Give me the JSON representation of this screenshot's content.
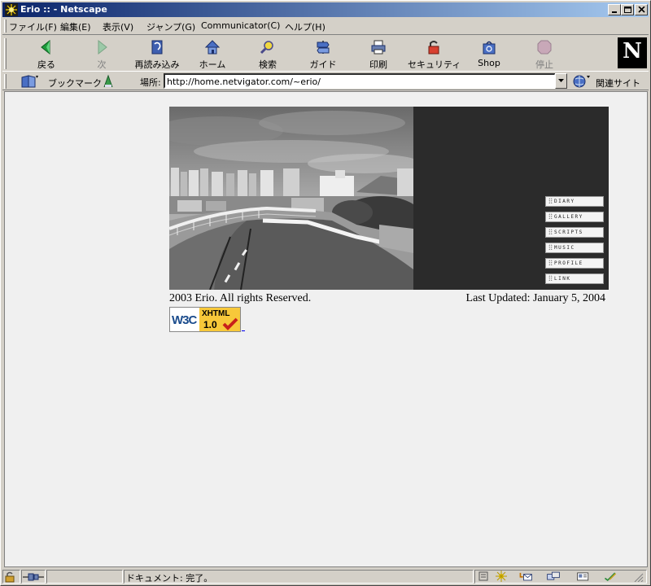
{
  "window": {
    "title": "Erio :: - Netscape"
  },
  "menu": [
    "ファイル(F)",
    "編集(E)",
    "表示(V)",
    "ジャンプ(G)",
    "Communicator(C)",
    "ヘルプ(H)"
  ],
  "toolbar": {
    "buttons": [
      {
        "label": "戻る",
        "icon": "back-icon",
        "enabled": true
      },
      {
        "label": "次",
        "icon": "forward-icon",
        "enabled": false
      },
      {
        "label": "再読み込み",
        "icon": "reload-icon",
        "enabled": true
      },
      {
        "label": "ホーム",
        "icon": "home-icon",
        "enabled": true
      },
      {
        "label": "検索",
        "icon": "search-icon",
        "enabled": true
      },
      {
        "label": "ガイド",
        "icon": "guide-icon",
        "enabled": true
      },
      {
        "label": "印刷",
        "icon": "print-icon",
        "enabled": true
      },
      {
        "label": "セキュリティ",
        "icon": "security-icon",
        "enabled": true
      },
      {
        "label": "Shop",
        "icon": "shop-icon",
        "enabled": true
      },
      {
        "label": "停止",
        "icon": "stop-icon",
        "enabled": false
      }
    ],
    "logo": "N"
  },
  "location": {
    "bookmarks_label": "ブックマーク",
    "label": "場所:",
    "url": "http://home.netvigator.com/~erio/",
    "related_label": "関連サイト"
  },
  "page": {
    "menu": [
      "DIARY",
      "GALLERY",
      "SCRIPTS",
      "MUSIC",
      "PROFILE",
      "LINK"
    ],
    "copyright": "2003 Erio. All rights Reserved.",
    "updated": "Last Updated: January 5, 2004",
    "badge": {
      "left": "W3C",
      "right_top": "XHTML",
      "right_bottom": "1.0"
    }
  },
  "status": {
    "text": "ドキュメント: 完了。"
  },
  "colors": {
    "titlebar": "#0a246a",
    "chrome": "#d4d0c8",
    "content_bg": "#f0f0f0",
    "banner_bg": "#2b2b2b",
    "badge_yellow": "#f7c83a"
  }
}
